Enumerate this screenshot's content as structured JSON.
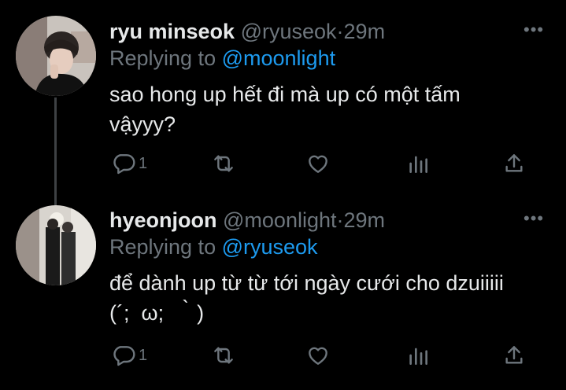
{
  "tweets": [
    {
      "name": "ryu minseok",
      "handle": "@ryuseok",
      "separator": "·",
      "time": "29m",
      "reply_prefix": "Replying to",
      "reply_to": "@moonlight",
      "text": "sao hong up hết đi mà up có một tấm\nvậyyy?",
      "reply_count": "1"
    },
    {
      "name": "hyeonjoon",
      "handle": "@moonlight",
      "separator": "·",
      "time": "29m",
      "reply_prefix": "Replying to",
      "reply_to": "@ryuseok",
      "text": "để dành up từ từ tới ngày cưới cho dzuiiiii\n(´;  ω;  ｀)",
      "reply_count": "1"
    }
  ],
  "more_label": "•••",
  "colors": {
    "background": "#000000",
    "muted": "#6e767d",
    "accent": "#1d9bf0",
    "text": "#e7e9ea"
  },
  "icons": [
    "reply-icon",
    "retweet-icon",
    "like-icon",
    "analytics-icon",
    "share-icon"
  ]
}
